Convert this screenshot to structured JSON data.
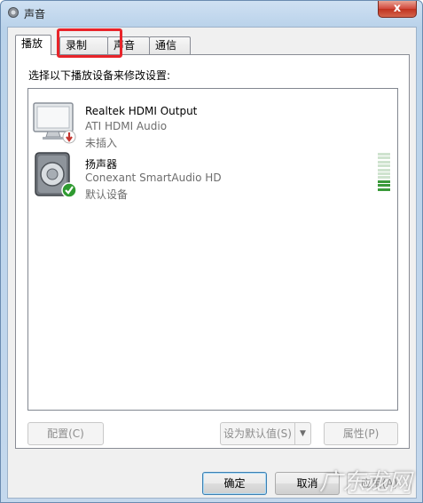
{
  "window": {
    "title": "声音",
    "close_label": "x"
  },
  "tabs": [
    {
      "label": "播放",
      "active": true
    },
    {
      "label": "录制",
      "active": false
    },
    {
      "label": "声音",
      "active": false
    },
    {
      "label": "通信",
      "active": false
    }
  ],
  "panel": {
    "instruction": "选择以下播放设备来修改设置:"
  },
  "devices": [
    {
      "name": "Realtek HDMI Output",
      "driver": "ATI HDMI Audio",
      "status": "未插入",
      "icon": "monitor-icon",
      "badge": "unplugged-badge-icon"
    },
    {
      "name": "扬声器",
      "driver": "Conexant SmartAudio HD",
      "status": "默认设备",
      "icon": "speaker-icon",
      "badge": "default-check-icon",
      "level_fraction": 0.3
    }
  ],
  "buttons": {
    "configure": "配置(C)",
    "set_default": "设为默认值(S)",
    "properties": "属性(P)",
    "ok": "确定",
    "cancel": "取消",
    "apply": "应用(A)"
  },
  "watermark": "广东龙网",
  "colors": {
    "highlight": "#e8242a",
    "meter_on": "#3a9a3a",
    "meter_off": "#cfe3cf"
  }
}
